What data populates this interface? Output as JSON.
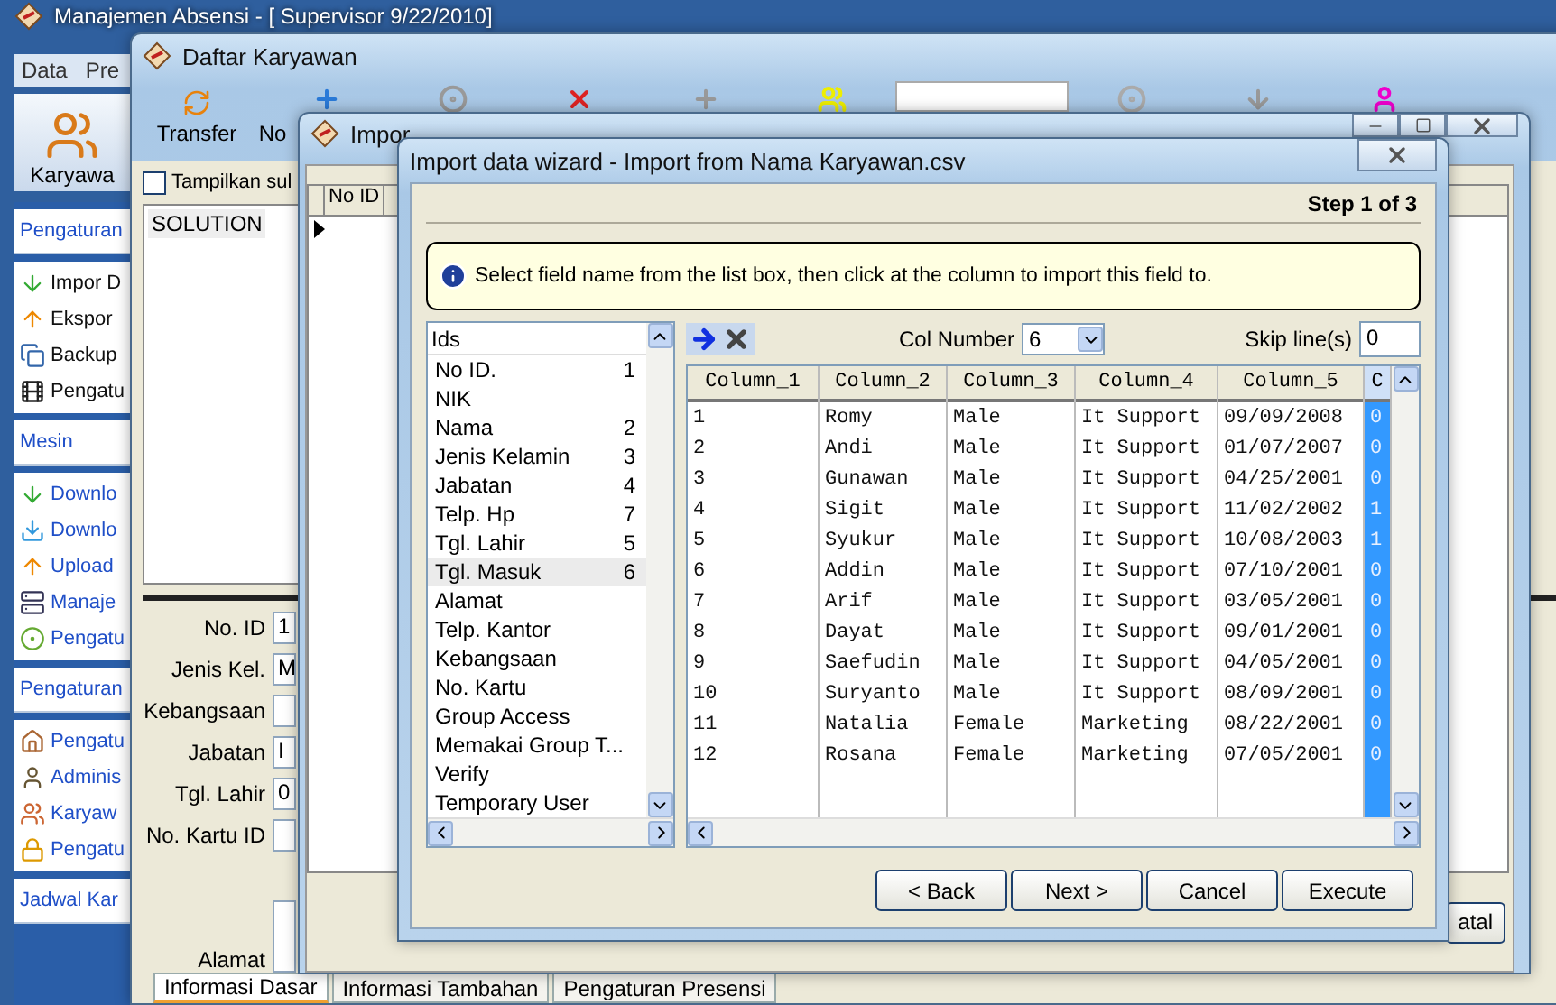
{
  "main_window": {
    "title": "Manajemen Absensi - [ Supervisor 9/22/2010]",
    "menu": [
      "Data",
      "Pre"
    ],
    "big_button": "Karyawa",
    "sidebar": [
      {
        "title": "Pengaturan",
        "items": [
          "Impor D",
          "Ekspor",
          "Backup",
          "Pengatu"
        ]
      },
      {
        "title": "Mesin",
        "items": [
          "Downlo",
          "Downlo",
          "Upload",
          "Manaje",
          "Pengatu"
        ]
      },
      {
        "title": "Pengaturan",
        "items": [
          "Pengatu",
          "Adminis",
          "Karyaw",
          "Pengatu"
        ]
      },
      {
        "title": "Jadwal Kar"
      }
    ]
  },
  "employee_window": {
    "title": "Daftar Karyawan",
    "toolbar": [
      "Transfer",
      "No"
    ],
    "show_checkbox": {
      "label": "Tampilkan sul",
      "checked": false
    },
    "list": [
      "SOLUTION"
    ],
    "form": [
      {
        "label": "No. ID",
        "value": "1",
        "kind": "text"
      },
      {
        "label": "Jenis Kel.",
        "value": "M",
        "kind": "text"
      },
      {
        "label": "Kebangsaan",
        "kind": "text"
      },
      {
        "label": "Jabatan",
        "value": "I",
        "kind": "text"
      },
      {
        "label": "Tgl. Lahir",
        "value": "0",
        "kind": "text"
      },
      {
        "label": "No. Kartu ID",
        "kind": "text"
      },
      {
        "label": "Alamat",
        "kind": "memo"
      }
    ],
    "tabs": [
      {
        "label": "Informasi Dasar",
        "selected": true
      },
      {
        "label": "Informasi Tambahan",
        "selected": false
      },
      {
        "label": "Pengaturan Presensi",
        "selected": false
      }
    ]
  },
  "import_window": {
    "title": "Impor",
    "grid_header": "No ID",
    "button": "atal"
  },
  "wizard": {
    "title": "Import data wizard - Import from Nama Karyawan.csv",
    "step": "Step 1 of 3",
    "info": "Select field name from the list box, then click at the column to import this field to.",
    "fields_header": "Ids",
    "fields": [
      {
        "name": "No ID.",
        "column": "1",
        "selected": false
      },
      {
        "name": "NIK",
        "selected": false
      },
      {
        "name": "Nama",
        "column": "2",
        "selected": false
      },
      {
        "name": "Jenis Kelamin",
        "column": "3",
        "selected": false
      },
      {
        "name": "Jabatan",
        "column": "4",
        "selected": false
      },
      {
        "name": "Telp. Hp",
        "column": "7",
        "selected": false
      },
      {
        "name": "Tgl. Lahir",
        "column": "5",
        "selected": false
      },
      {
        "name": "Tgl. Masuk",
        "column": "6",
        "selected": true
      },
      {
        "name": "Alamat",
        "selected": false
      },
      {
        "name": "Telp. Kantor",
        "selected": false
      },
      {
        "name": "Kebangsaan",
        "selected": false
      },
      {
        "name": "No. Kartu",
        "selected": false
      },
      {
        "name": "Group Access",
        "selected": false
      },
      {
        "name": "Memakai Group T...",
        "selected": false
      },
      {
        "name": "Verify",
        "selected": false
      },
      {
        "name": "Temporary User",
        "selected": false
      }
    ],
    "col_number_label": "Col Number",
    "col_number": "6",
    "skip_label": "Skip line(s)",
    "skip": "0",
    "columns": [
      {
        "label": "Column_1",
        "selected": false
      },
      {
        "label": "Column_2",
        "selected": false
      },
      {
        "label": "Column_3",
        "selected": false
      },
      {
        "label": "Column_4",
        "selected": false
      },
      {
        "label": "Column_5",
        "selected": false
      },
      {
        "label": "C",
        "selected": true
      }
    ],
    "rows": [
      [
        "1",
        "Romy",
        "Male",
        "It Support",
        "09/09/2008",
        "0"
      ],
      [
        "2",
        "Andi",
        "Male",
        "It Support",
        "01/07/2007",
        "0"
      ],
      [
        "3",
        "Gunawan",
        "Male",
        "It Support",
        "04/25/2001",
        "0"
      ],
      [
        "4",
        "Sigit",
        "Male",
        "It Support",
        "11/02/2002",
        "1"
      ],
      [
        "5",
        "Syukur",
        "Male",
        "It Support",
        "10/08/2003",
        "1"
      ],
      [
        "6",
        "Addin",
        "Male",
        "It Support",
        "07/10/2001",
        "0"
      ],
      [
        "7",
        "Arif",
        "Male",
        "It Support",
        "03/05/2001",
        "0"
      ],
      [
        "8",
        "Dayat",
        "Male",
        "It Support",
        "09/01/2001",
        "0"
      ],
      [
        "9",
        "Saefudin",
        "Male",
        "It Support",
        "04/05/2001",
        "0"
      ],
      [
        "10",
        "Suryanto",
        "Male",
        "It Support",
        "08/09/2001",
        "0"
      ],
      [
        "11",
        "Natalia",
        "Female",
        "Marketing",
        "08/22/2001",
        "0"
      ],
      [
        "12",
        "Rosana",
        "Female",
        "Marketing",
        "07/05/2001",
        "0"
      ]
    ],
    "buttons": [
      "< Back",
      "Next >",
      "Cancel",
      "Execute"
    ]
  }
}
